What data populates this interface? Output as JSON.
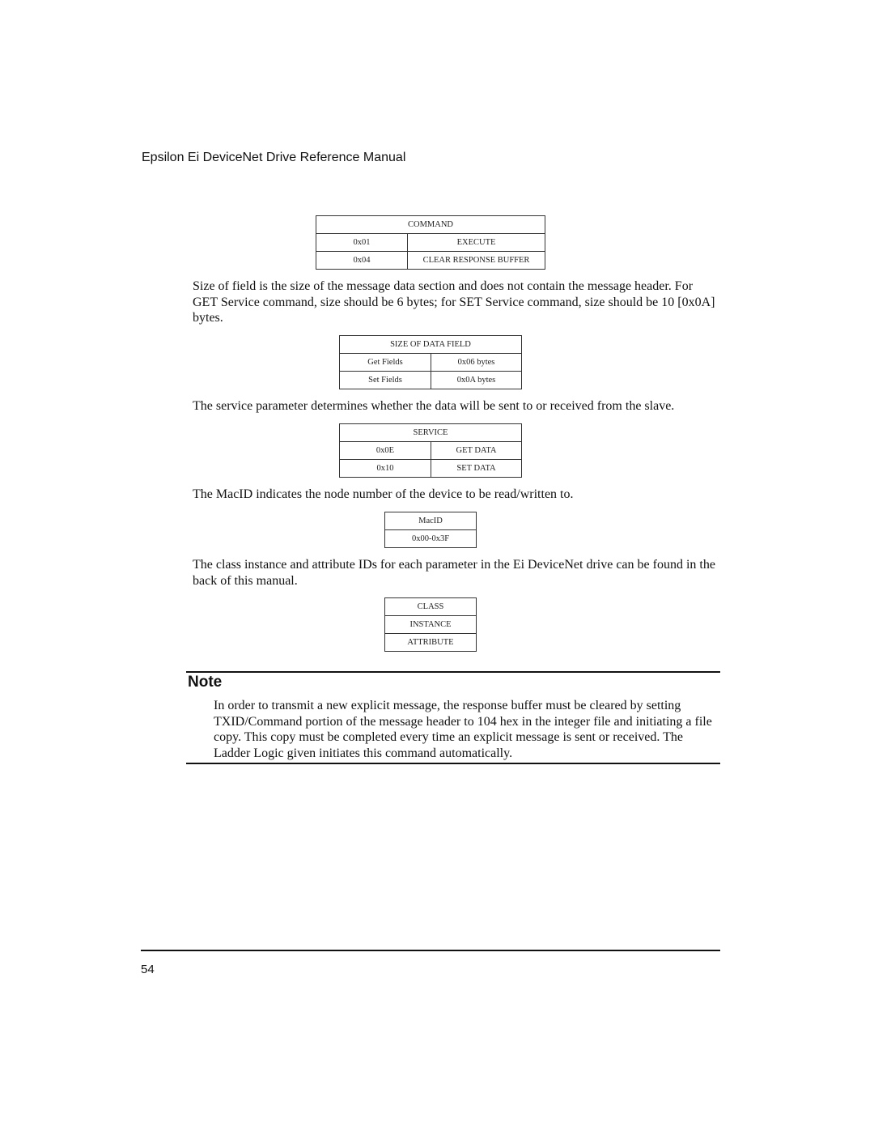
{
  "header": {
    "title": "Epsilon Ei DeviceNet Drive Reference Manual"
  },
  "tables": {
    "command": {
      "title": "COMMAND",
      "rows": [
        {
          "code": "0x01",
          "label": "EXECUTE"
        },
        {
          "code": "0x04",
          "label": "CLEAR RESPONSE BUFFER"
        }
      ]
    },
    "size_of_data_field": {
      "title": "SIZE OF DATA FIELD",
      "rows": [
        {
          "field": "Get Fields",
          "size": "0x06 bytes"
        },
        {
          "field": "Set Fields",
          "size": "0x0A bytes"
        }
      ]
    },
    "service": {
      "title": "SERVICE",
      "rows": [
        {
          "code": "0x0E",
          "label": "GET DATA"
        },
        {
          "code": "0x10",
          "label": "SET DATA"
        }
      ]
    },
    "macid": {
      "title": "MacID",
      "range": "0x00-0x3F"
    },
    "class_instance_attribute": {
      "rows": [
        "CLASS",
        "INSTANCE",
        "ATTRIBUTE"
      ]
    }
  },
  "paragraphs": {
    "size_of_field": "Size of field is the size of the message data section and does not contain the message header. For GET Service command, size should be 6 bytes; for SET Service command, size should be 10 [0x0A] bytes.",
    "service_param": "The service parameter determines whether the data will be sent to or received from the slave.",
    "macid": "The MacID indicates the node number of the device to be read/written to.",
    "class_instance": "The class instance and attribute IDs for each parameter in the Ei DeviceNet drive can be found in the back of this manual."
  },
  "note": {
    "title": "Note",
    "body": "In order to transmit a new explicit message, the response buffer must be cleared by setting TXID/Command portion of the message header to 104 hex in the integer file and initiating a file copy. This copy must be completed every time an explicit message is sent or received. The Ladder Logic given initiates this command automatically."
  },
  "footer": {
    "page_number": "54"
  }
}
